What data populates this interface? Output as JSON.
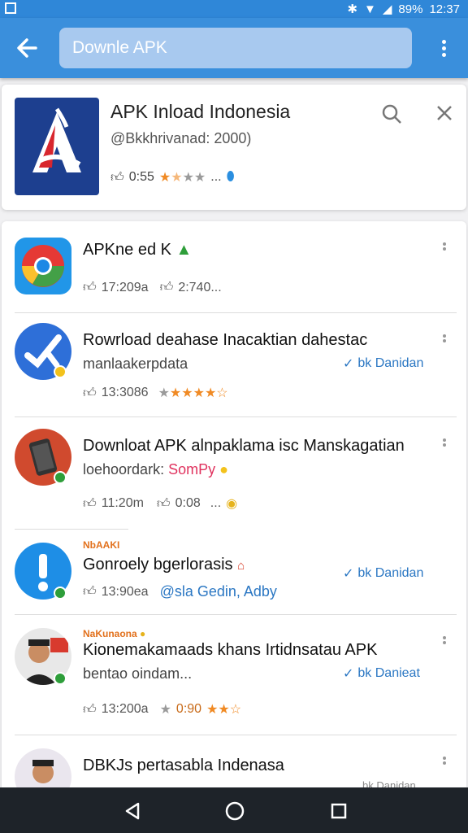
{
  "status_bar": {
    "battery": "89%",
    "time": "12:37"
  },
  "app_bar": {
    "search_text": "Downle APK"
  },
  "top_result": {
    "title": "APK Inload Indonesia",
    "subtitle": "@Bkkhrivanad: 2000)",
    "meta": "0:55",
    "rating_stars": 1.5,
    "ellipsis": "..."
  },
  "items": [
    {
      "title": "APKne ed K",
      "meta1": "17:209a",
      "meta2": "2:740...",
      "icon": "chrome-icon"
    },
    {
      "title": "Rowrload deahase Inacaktian dahestac",
      "subtitle": "manlaakerpdata",
      "publisher": "bk Danidan",
      "meta": "13:3086",
      "rating_stars": 4.5,
      "icon": "tools-icon"
    },
    {
      "title": "Downloat APK alnpaklama isc Manskagatian",
      "subtitle": "loehoordark:",
      "subtitle_accent": "SomPy",
      "meta1": "11:20m",
      "meta2": "0:08",
      "ellipsis": "...",
      "icon": "phone-icon"
    },
    {
      "label": "NbAAKI",
      "title": "Gonroely bgerlorasis",
      "publisher": "bk Danidan",
      "meta": "13:90ea",
      "meta_link": "@sla Gedin, Adby",
      "icon": "exclamation-icon"
    },
    {
      "label": "NaKunaona",
      "title": "Kionemakamaads khans Irtidnsatau APK",
      "subtitle": "bentao oindam...",
      "publisher": "bk Danieat",
      "meta1": "13:200a",
      "meta2": "0:90",
      "rating_stars": 2.5,
      "icon": "person-icon"
    },
    {
      "title": "DBKJs pertasabla Indenasa",
      "publisher": "bk Danidan",
      "icon": "person-icon"
    }
  ],
  "colors": {
    "accent": "#3a8fdc",
    "star": "#f08a24",
    "publisher": "#2b77c3"
  }
}
